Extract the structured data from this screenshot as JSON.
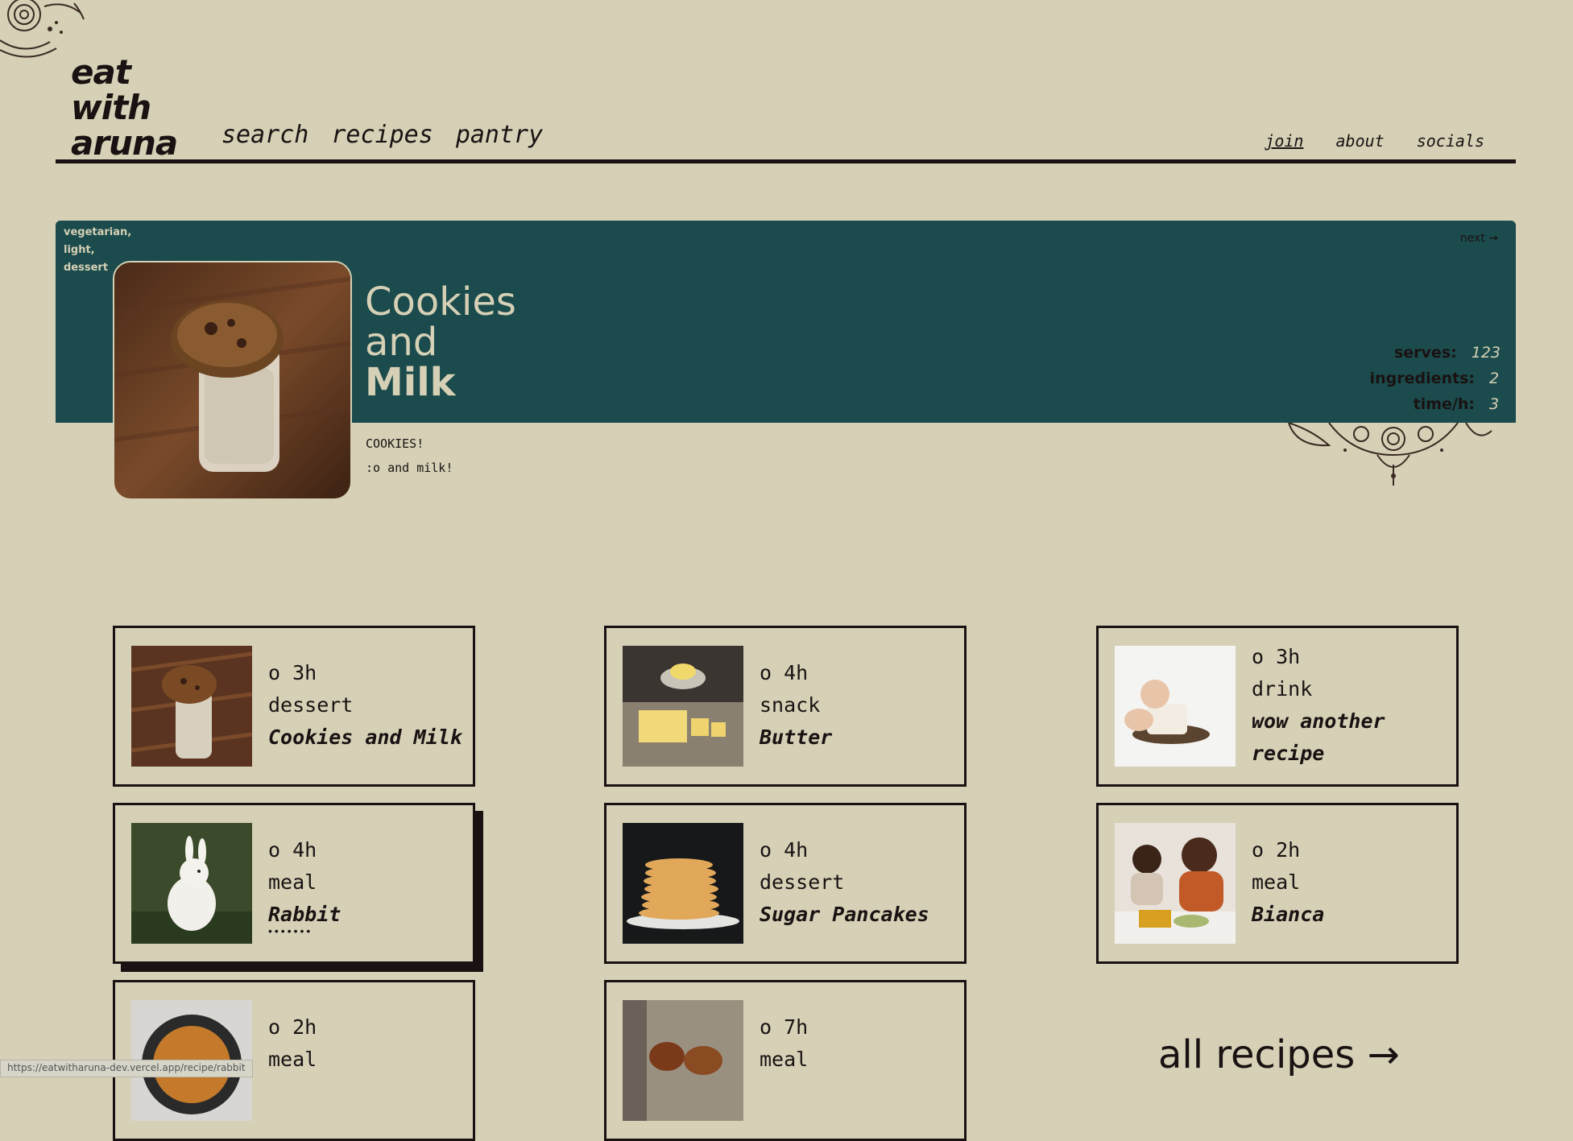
{
  "brand": {
    "line1": "eat",
    "line2": "with",
    "line3": "aruna"
  },
  "main_nav": [
    "search",
    "recipes",
    "pantry"
  ],
  "sub_nav": [
    "join",
    "about",
    "socials"
  ],
  "hero": {
    "tags": [
      "vegetarian,",
      "light,",
      "dessert"
    ],
    "next_label": "next →",
    "title_line1": "Cookies",
    "title_line2": "and",
    "title_line3": "Milk",
    "image": "cookie-milk-photo",
    "stats": [
      {
        "label": "serves:",
        "value": "123"
      },
      {
        "label": "ingredients:",
        "value": "2"
      },
      {
        "label": "time/h:",
        "value": "3"
      }
    ],
    "description": [
      "COOKIES!",
      ":o and milk!"
    ]
  },
  "recipe_cards": [
    {
      "time": "o 3h",
      "category": "dessert",
      "title": "Cookies and Milk",
      "image": "cookie-milk-photo"
    },
    {
      "time": "o 4h",
      "category": "snack",
      "title": "Butter",
      "image": "butter-photo"
    },
    {
      "time": "o 3h",
      "category": "drink",
      "title": "wow another recipe",
      "image": "baby-cake-photo"
    },
    {
      "time": "o 4h",
      "category": "meal",
      "title": "Rabbit",
      "image": "rabbit-photo",
      "hovered": true,
      "dots": "•••••••"
    },
    {
      "time": "o 4h",
      "category": "dessert",
      "title": "Sugar Pancakes",
      "image": "pancakes-photo"
    },
    {
      "time": "o 2h",
      "category": "meal",
      "title": "Bianca",
      "image": "family-dinner-photo"
    },
    {
      "time": "o 2h",
      "category": "meal",
      "title": "",
      "image": "pan-dish-photo"
    },
    {
      "time": "o 7h",
      "category": "meal",
      "title": "",
      "image": "chickens-photo"
    }
  ],
  "all_recipes_label": "all recipes →",
  "status_url": "https://eatwitharuna-dev.vercel.app/recipe/rabbit",
  "colors": {
    "background": "#d5d0b6",
    "accent": "#1b4b4c",
    "ink": "#1a1212"
  }
}
